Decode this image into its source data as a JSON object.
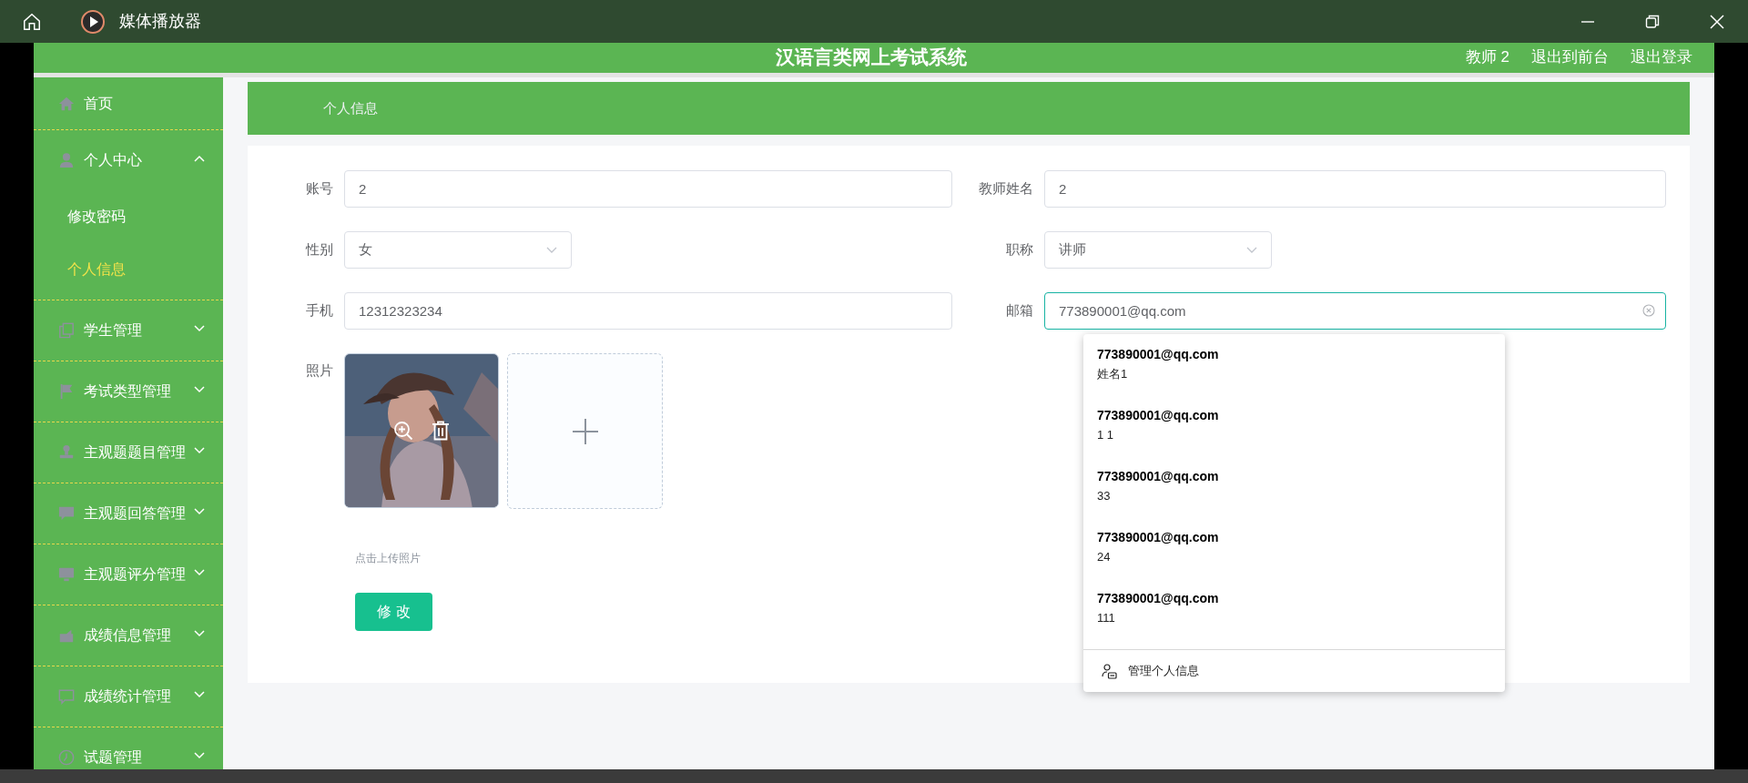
{
  "player_window": {
    "title": "媒体播放器"
  },
  "header": {
    "title": "汉语言类网上考试系统",
    "links": [
      "教师 2",
      "退出到前台",
      "退出登录"
    ]
  },
  "sidebar": {
    "items": [
      {
        "label": "首页",
        "kind": "link"
      },
      {
        "label": "个人中心",
        "kind": "menu",
        "expanded": true,
        "children": [
          {
            "label": "修改密码",
            "selected": false
          },
          {
            "label": "个人信息",
            "selected": true
          }
        ]
      },
      {
        "label": "学生管理",
        "kind": "menu",
        "expanded": false
      },
      {
        "label": "考试类型管理",
        "kind": "menu",
        "expanded": false
      },
      {
        "label": "主观题题目管理",
        "kind": "menu",
        "expanded": false
      },
      {
        "label": "主观题回答管理",
        "kind": "menu",
        "expanded": false
      },
      {
        "label": "主观题评分管理",
        "kind": "menu",
        "expanded": false
      },
      {
        "label": "成绩信息管理",
        "kind": "menu",
        "expanded": false
      },
      {
        "label": "成绩统计管理",
        "kind": "menu",
        "expanded": false
      },
      {
        "label": "试题管理",
        "kind": "menu",
        "expanded": false
      }
    ]
  },
  "breadcrumb": "个人信息",
  "form": {
    "fields": [
      {
        "label": "账号",
        "kind": "input",
        "value": "2",
        "focused": false
      },
      {
        "label": "教师姓名",
        "kind": "input",
        "value": "2",
        "focused": false
      },
      {
        "label": "性别",
        "kind": "select",
        "value": "女",
        "focused": false
      },
      {
        "label": "职称",
        "kind": "select",
        "value": "讲师",
        "focused": false
      },
      {
        "label": "手机",
        "kind": "input",
        "value": "12312323234",
        "focused": false
      },
      {
        "label": "邮箱",
        "kind": "input",
        "value": "773890001@qq.com",
        "focused": true
      }
    ],
    "photo": {
      "label": "照片",
      "hint": "点击上传照片"
    },
    "submit": "修 改"
  },
  "autocomplete": {
    "items": [
      {
        "title": "773890001@qq.com",
        "subtitle": "姓名1"
      },
      {
        "title": "773890001@qq.com",
        "subtitle": "1 1"
      },
      {
        "title": "773890001@qq.com",
        "subtitle": "33"
      },
      {
        "title": "773890001@qq.com",
        "subtitle": "24"
      },
      {
        "title": "773890001@qq.com",
        "subtitle": "111"
      }
    ],
    "footer": "管理个人信息"
  }
}
